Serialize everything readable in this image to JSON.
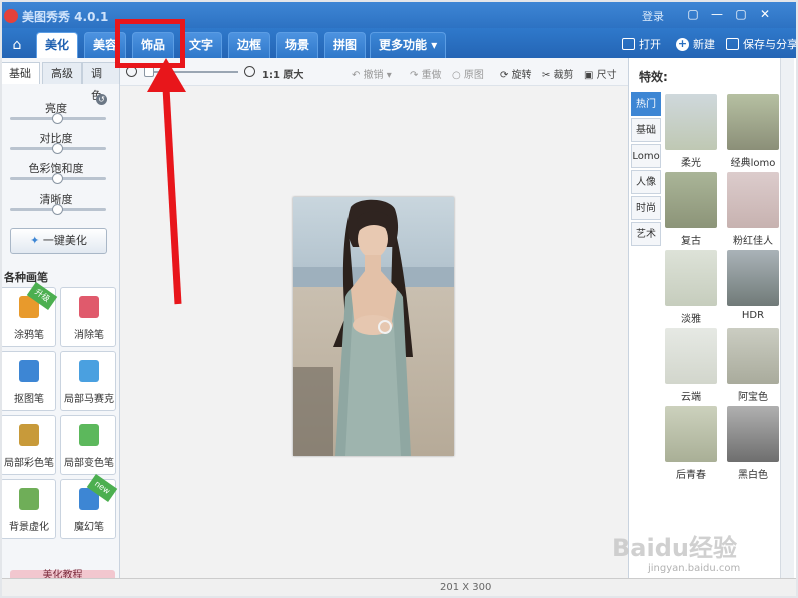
{
  "window": {
    "title": "美图秀秀 4.0.1",
    "login": "登录",
    "controls": [
      "▢",
      "—",
      "▢",
      "✕"
    ]
  },
  "tabs": [
    {
      "label": "美化",
      "active": true
    },
    {
      "label": "美容",
      "active": false
    },
    {
      "label": "饰品",
      "active": false
    },
    {
      "label": "文字",
      "active": false
    },
    {
      "label": "边框",
      "active": false
    },
    {
      "label": "场景",
      "active": false
    },
    {
      "label": "拼图",
      "active": false
    },
    {
      "label": "更多功能",
      "active": false
    }
  ],
  "toolbar_right": {
    "open": "打开",
    "new": "新建",
    "save": "保存与分享"
  },
  "left_panel": {
    "subtabs": [
      "基础",
      "高级",
      "调色"
    ],
    "sliders": [
      {
        "label": "亮度",
        "value": 0.5
      },
      {
        "label": "对比度",
        "value": 0.5
      },
      {
        "label": "色彩饱和度",
        "value": 0.5
      },
      {
        "label": "清晰度",
        "value": 0.5
      }
    ],
    "one_key": "一键美化",
    "brush_title": "各种画笔",
    "brushes": [
      {
        "label": "涂鸦笔",
        "badge": "升级",
        "color": "#e89a2c"
      },
      {
        "label": "消除笔",
        "badge": "",
        "color": "#e05a6c"
      },
      {
        "label": "抠图笔",
        "badge": "",
        "color": "#3d86d4"
      },
      {
        "label": "局部马赛克",
        "badge": "",
        "color": "#4aa0e0"
      },
      {
        "label": "局部彩色笔",
        "badge": "",
        "color": "#c89a3a"
      },
      {
        "label": "局部变色笔",
        "badge": "",
        "color": "#5cb85c"
      },
      {
        "label": "背景虚化",
        "badge": "",
        "color": "#6fae58"
      },
      {
        "label": "魔幻笔",
        "badge": "new",
        "color": "#3d86d4"
      }
    ],
    "tutorial": "美化教程"
  },
  "canvas_toolbar": {
    "zoom_label": "1:1 原大",
    "undo": "撤销",
    "redo": "重做",
    "original": "原图",
    "rotate": "旋转",
    "crop": "裁剪",
    "size": "尺寸"
  },
  "right_panel": {
    "title": "特效:",
    "categories": [
      {
        "label": "热门",
        "active": true
      },
      {
        "label": "基础",
        "active": false
      },
      {
        "label": "Lomo",
        "active": false
      },
      {
        "label": "人像",
        "active": false
      },
      {
        "label": "时尚",
        "active": false
      },
      {
        "label": "艺术",
        "active": false
      }
    ],
    "effects": [
      {
        "label": "柔光",
        "tint": "#cfd8c8"
      },
      {
        "label": "经典lomo",
        "tint": "#b9c4a6"
      },
      {
        "label": "复古",
        "tint": "#a9b48e"
      },
      {
        "label": "粉红佳人",
        "tint": "#d9c6c6"
      },
      {
        "label": "淡雅",
        "tint": "#d6dccf"
      },
      {
        "label": "HDR",
        "tint": "#a8b0b6"
      },
      {
        "label": "云端",
        "tint": "#e3e6e1"
      },
      {
        "label": "阿宝色",
        "tint": "#c6c9bd"
      },
      {
        "label": "后青春",
        "tint": "#c8cdb8"
      },
      {
        "label": "黑白色",
        "tint": "#9d9d9d"
      }
    ]
  },
  "status": {
    "size": "201 X 300"
  },
  "colors": {
    "accent": "#2a6fc0",
    "annotation": "#e8161b"
  },
  "watermark": {
    "text": "Baidu经验",
    "sub": "jingyan.baidu.com"
  }
}
